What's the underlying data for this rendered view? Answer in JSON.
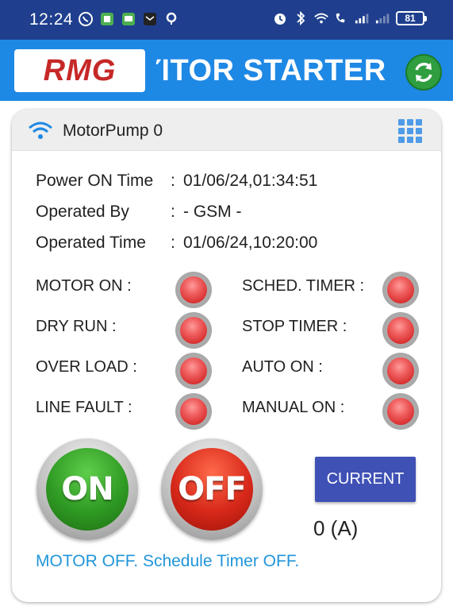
{
  "status_bar": {
    "time": "12:24",
    "battery": "81",
    "icons_left": [
      "whatsapp-icon",
      "app-icon",
      "message-icon",
      "mail-icon",
      "location-icon"
    ],
    "icons_right": [
      "alarm-icon",
      "bluetooth-icon",
      "wifi-icon",
      "call-wifi-icon",
      "signal-icon",
      "signal-icon"
    ]
  },
  "header": {
    "logo": "RMG",
    "title": "ΊTOR STARTER"
  },
  "card": {
    "device_name": "MotorPump 0",
    "info": [
      {
        "label": "Power ON Time",
        "value": "01/06/24,01:34:51"
      },
      {
        "label": "Operated By",
        "value": "- GSM -"
      },
      {
        "label": "Operated Time",
        "value": "01/06/24,10:20:00"
      }
    ],
    "status_left": [
      "MOTOR ON :",
      "DRY RUN :",
      "OVER LOAD :",
      "LINE FAULT :"
    ],
    "status_right": [
      "SCHED. TIMER :",
      "STOP TIMER :",
      "AUTO ON :",
      "MANUAL ON :"
    ],
    "on_label": "ON",
    "off_label": "OFF",
    "current_button": "CURRENT",
    "current_value": "0 (A)",
    "message": "MOTOR OFF. Schedule Timer OFF."
  },
  "colors": {
    "status_bar": "#1f3f8e",
    "header": "#1e88e5",
    "led_off": "#e53935",
    "current_button": "#3f51b5",
    "message": "#2196d9"
  }
}
